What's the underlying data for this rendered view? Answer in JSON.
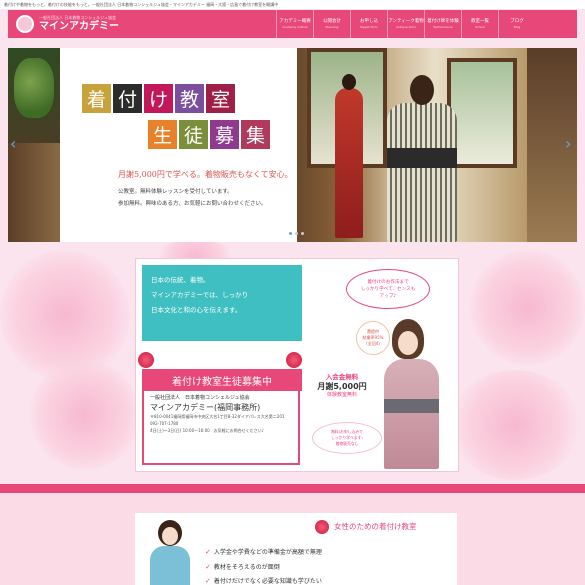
{
  "header": {
    "tagline": "着付けや着物をもっと、着付けの技能をもっと。一般社団法人 日本着物コンシェルジュ協会・マインアカデミー 福岡・大阪・広島で着付け教室を開講中",
    "logo_subtitle": "一般社団法人 日本着物コンシェルジュ協会",
    "logo_title": "マインアカデミー",
    "nav": [
      {
        "jp": "アカデミー概要",
        "en": "Academy outline"
      },
      {
        "jp": "公開会計",
        "en": "Planning"
      },
      {
        "jp": "お申し込",
        "en": "Regist form"
      },
      {
        "jp": "アンティーク着物",
        "en": "Antique kimo"
      },
      {
        "jp": "着付け師を体験",
        "en": "Performance"
      },
      {
        "jp": "教室一覧",
        "en": "School"
      },
      {
        "jp": "ブログ",
        "en": "Blog"
      }
    ]
  },
  "hero": {
    "title_row1": [
      "着",
      "付",
      "け",
      "教",
      "室"
    ],
    "title_row2": [
      "生",
      "徒",
      "募",
      "集"
    ],
    "tile_colors_row1": [
      "#c8a23a",
      "#2c2c2c",
      "#c2185b",
      "#7b4f9d",
      "#9e1f48"
    ],
    "tile_colors_row2": [
      "#e8822a",
      "#7b8f3a",
      "#8e3a8e",
      "#b03a5b"
    ],
    "line1": "月謝5,000円で学べる。着物販売もなくて安心。",
    "line2": "公教室。無料体験レッスンを受付しています。",
    "line3": "参加無料。興味のある方、お気軽にお問い合わせください。",
    "prev_icon": "‹",
    "next_icon": "›"
  },
  "promo": {
    "teal_lines": [
      "日本の伝統、着物。",
      "マインアカデミーでは、しっかり",
      "日本文化と和の心を伝えます。"
    ],
    "speech_lines": [
      "着付けのお作法まで",
      "しっかり学べて、センスも",
      "アップ♪"
    ],
    "badge_lines": [
      "費提供",
      "結業率95%",
      "(全回4)"
    ],
    "ribbon": "着付け教室生徒募集中",
    "assoc_small": "一般社団法人　日本着物コンシェルジュ協会",
    "assoc_name": "マインアカデミー(福岡事務所)",
    "assoc_lines": [
      "〒810-0041福岡県福岡市中央区大名1丁目8-32ダイアパレス大名第二201",
      "092-707-1780",
      "4日(土)〜3日(日) 10:00〜16:00　お気軽にお問合せください♪"
    ],
    "fee_line1": "入会金無料",
    "fee_line2": "月謝5,000円",
    "fee_line3": "体験教室無料",
    "note_lines": [
      "無料(お申し込みで",
      "しっかり学べます!",
      "着物販売なし"
    ]
  },
  "lower": {
    "title": "女性のための着付け教室",
    "bullets": [
      "入学金や学費などの準備金が高額で無理",
      "教材をそろえるのが面倒",
      "着付けだけでなく必要な知識も学びたい"
    ]
  }
}
